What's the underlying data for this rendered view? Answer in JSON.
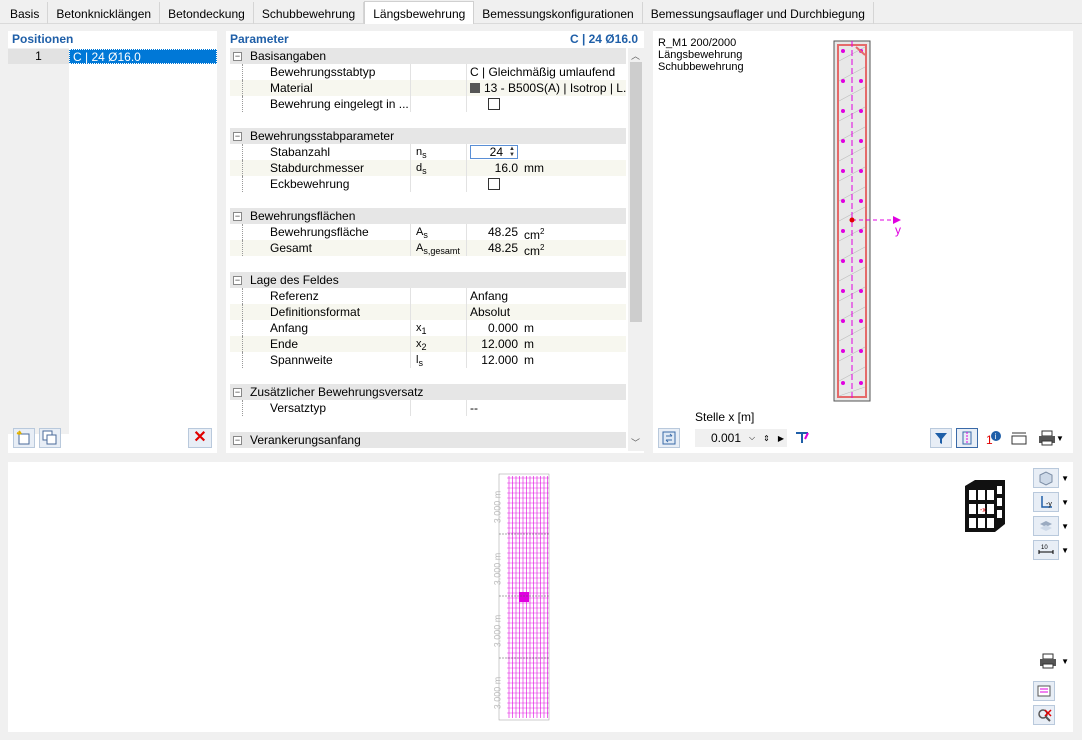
{
  "tabs": [
    {
      "label": "Basis"
    },
    {
      "label": "Betonknicklängen"
    },
    {
      "label": "Betondeckung"
    },
    {
      "label": "Schubbewehrung"
    },
    {
      "label": "Längsbewehrung",
      "active": true
    },
    {
      "label": "Bemessungskonfigurationen"
    },
    {
      "label": "Bemessungsauflager und Durchbiegung"
    }
  ],
  "positions": {
    "title": "Positionen",
    "rows": [
      {
        "index": "1",
        "name": "C | 24 Ø16.0"
      }
    ]
  },
  "parameters": {
    "title": "Parameter",
    "subtitle": "C | 24 Ø16.0",
    "groups": [
      {
        "title": "Basisangaben",
        "items": [
          {
            "name": "Bewehrungsstabtyp",
            "symbol": "",
            "value": "C | Gleichmäßig umlaufend",
            "unit": ""
          },
          {
            "name": "Material",
            "symbol": "",
            "value": "13 - B500S(A) | Isotrop | L...",
            "unit": ""
          },
          {
            "name": "Bewehrung eingelegt in ...",
            "symbol": "",
            "value": "",
            "unit": "",
            "checkbox": true
          }
        ]
      },
      {
        "title": "Bewehrungsstabparameter",
        "items": [
          {
            "name": "Stabanzahl",
            "symbol": "ns",
            "value": "24",
            "unit": "",
            "spinner": true
          },
          {
            "name": "Stabdurchmesser",
            "symbol": "ds",
            "value": "16.0",
            "unit": "mm"
          },
          {
            "name": "Eckbewehrung",
            "symbol": "",
            "value": "",
            "unit": "",
            "checkbox": true
          }
        ]
      },
      {
        "title": "Bewehrungsflächen",
        "items": [
          {
            "name": "Bewehrungsfläche",
            "symbol": "As",
            "value": "48.25",
            "unit": "cm2"
          },
          {
            "name": "Gesamt",
            "symbol": "As,gesamt",
            "value": "48.25",
            "unit": "cm2"
          }
        ]
      },
      {
        "title": "Lage des Feldes",
        "items": [
          {
            "name": "Referenz",
            "symbol": "",
            "value": "Anfang",
            "unit": ""
          },
          {
            "name": "Definitionsformat",
            "symbol": "",
            "value": "Absolut",
            "unit": ""
          },
          {
            "name": "Anfang",
            "symbol": "x1",
            "value": "0.000",
            "unit": "m"
          },
          {
            "name": "Ende",
            "symbol": "x2",
            "value": "12.000",
            "unit": "m"
          },
          {
            "name": "Spannweite",
            "symbol": "ls",
            "value": "12.000",
            "unit": "m"
          }
        ]
      },
      {
        "title": "Zusätzlicher Bewehrungsversatz",
        "items": [
          {
            "name": "Versatztyp",
            "symbol": "",
            "value": "--",
            "unit": ""
          }
        ]
      },
      {
        "title": "Verankerungsanfang",
        "items": []
      }
    ]
  },
  "preview": {
    "lines": [
      "R_M1 200/2000",
      "Längsbewehrung",
      "Schubbewehrung"
    ],
    "stelle_label": "Stelle x [m]",
    "stelle_value": "0.001",
    "axis_label": "y"
  },
  "model3d": {
    "dim_labels": [
      "3.000 m",
      "3.000 m",
      "3.000 m",
      "3.000 m"
    ]
  },
  "colors": {
    "accent": "#0078d7",
    "rebar": "#e000e0",
    "section": "#e56a6a"
  },
  "icons": [
    "add-position-icon",
    "copy-position-icon",
    "delete-icon",
    "filter-icon",
    "print-icon",
    "view-cube-icon"
  ]
}
